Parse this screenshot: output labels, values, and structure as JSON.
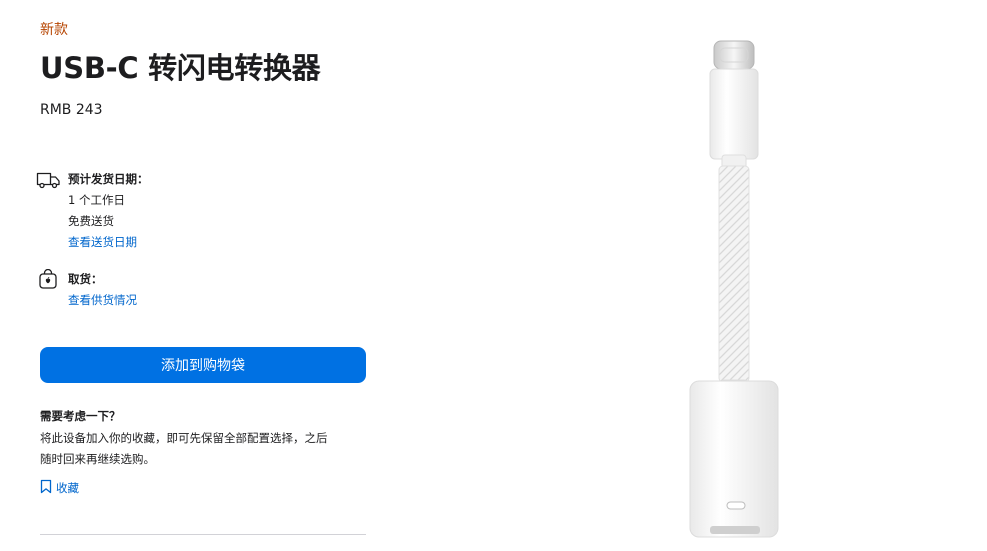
{
  "product": {
    "new_label": "新款",
    "title": "USB-C 转闪电转换器",
    "price": "RMB 243"
  },
  "delivery": {
    "icon": "truck-icon",
    "heading": "预计发货日期：",
    "days": "1 个工作日",
    "shipping": "免费送货",
    "link": "查看送货日期"
  },
  "pickup": {
    "icon": "bag-icon",
    "heading": "取货：",
    "link": "查看供货情况"
  },
  "actions": {
    "add_to_bag": "添加到购物袋"
  },
  "consider": {
    "title": "需要考虑一下？",
    "line1": "将此设备加入你的收藏，即可先保留全部配置选择，之后",
    "line2": "随时回来再继续选购。",
    "save_label": "收藏",
    "save_icon": "bookmark-icon"
  },
  "colors": {
    "accent": "#0071e3",
    "link": "#0066cc",
    "new_label": "#b64400"
  }
}
